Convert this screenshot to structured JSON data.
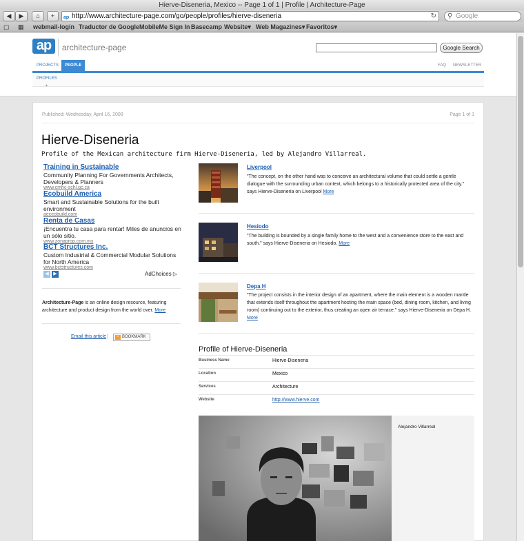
{
  "browser": {
    "window_title": "Hierve-Diseneria, Mexico -- Page 1 of 1 | Profile | Architecture-Page",
    "url": "http://www.architecture-page.com/go/people/profiles/hierve-diseneria",
    "search_placeholder": "Google",
    "bookmarks": [
      "webmail-login",
      "Traductor de Google",
      "MobileMe Sign In",
      "Basecamp",
      "Website",
      "Web Magazines",
      "Favoritos"
    ]
  },
  "site": {
    "logo": "ap",
    "name": "architecture-page",
    "search_button": "Google Search",
    "nav": {
      "projects": "PROJECTS",
      "people": "PEOPLE",
      "faq": "FAQ",
      "newsletter": "NEWSLETTER"
    },
    "subnav": "PROFILES"
  },
  "article": {
    "published": "Published: Wednesday, April 16, 2008",
    "page": "Page 1 of 1",
    "title": "Hierve-Diseneria",
    "subtitle": "Profile of the Mexican architecture firm Hierve-Diseneria, led by Alejandro Villarreal."
  },
  "ads": [
    {
      "title": "Training in Sustainable",
      "text": "Community Planning For Governments Architects, Developers & Planners",
      "url": "www.cmhc-schl.gc.ca"
    },
    {
      "title": "Ecobuild America",
      "text": "Smart and Sustainable Solutions for the built environment",
      "url": "aeceobuild.com"
    },
    {
      "title": "Renta de Casas",
      "text": "¡Encuentra tu casa para rentar! Miles de anuncios en un sólo sitio.",
      "url": "www.zonaprop.com.mx"
    },
    {
      "title": "BCT Structures Inc.",
      "text": "Custom Industrial & Commercial Modular Solutions for North America",
      "url": "www.bctstructures.com"
    }
  ],
  "adchoices": "AdChoices",
  "about": {
    "brand": "Architecture-Page",
    "text": " is an online design resource, featuring architecture and product design from the world over. ",
    "more": "More"
  },
  "share": {
    "email": "Email this article",
    "sep": "|",
    "bookmark": "BOOKMARK"
  },
  "projects": [
    {
      "name": "Liverpool",
      "desc": "\"The concept, on the other hand was to conceive an architectural volume that could settle a gentle dialogue with the surrounding urban context, which belongs to a historically protected area of the city.\" says Hierve-Diseneria on Liverpool ",
      "more": "More"
    },
    {
      "name": "Hesiodo",
      "desc": "\"The building is bounded by a single family home to the west and a convenience store to the east and south.\" says Hierve-Diseneria on Hesiodo. ",
      "more": "More"
    },
    {
      "name": "Depa H",
      "desc": "\"The project consists in the interior design of an apartment, where the main element is a wooden mantle that extends itself throughout the apartment hosting the main space (bed, dining room, kitchen, and living room) continuing out to the exterior, thus creating an open air terrace.\" says Hierve-Diseneria on Depa H. ",
      "more": "More"
    }
  ],
  "profile": {
    "heading": "Profile of Hierve-Diseneria",
    "rows": [
      {
        "label": "Business Name",
        "value": "Hierve-Diseneria"
      },
      {
        "label": "Location",
        "value": "Mexico"
      },
      {
        "label": "Services",
        "value": "Architecture"
      },
      {
        "label": "Website",
        "value": "http://www.hierve.com"
      }
    ],
    "photo_caption": "Alejandro Villarreal"
  }
}
